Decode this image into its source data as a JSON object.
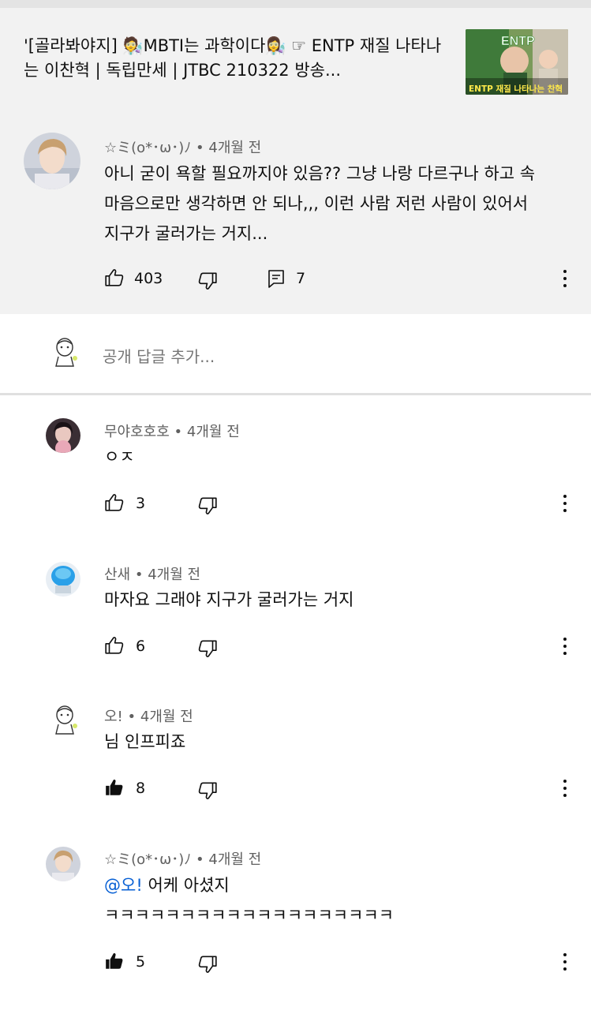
{
  "video": {
    "title": "'[골라봐야지] 🧑‍🔬MBTI는 과학이다👩‍🔬 ☞ ENTP 재질 나타나는 이찬혁 | 독립만세 | JTBC 210322 방송...",
    "thumbnail_tag": "ENTP",
    "thumbnail_caption": "ENTP 재질 나타나는 찬혁"
  },
  "main_comment": {
    "author": "☆ミ(o*･ω･)ﾉ",
    "time": "4개월 전",
    "text": "아니 굳이 욕할 필요까지야 있음?? 그냥 나랑 다르구나 하고 속마음으로만 생각하면 안 되나,,, 이런 사람 저런 사람이 있어서 지구가 굴러가는 거지...",
    "likes": "403",
    "replies": "7"
  },
  "reply_box": {
    "placeholder": "공개 답글 추가..."
  },
  "replies": [
    {
      "author": "무야호호호",
      "time": "4개월 전",
      "text": "ㅇㅈ",
      "likes": "3"
    },
    {
      "author": "산새",
      "time": "4개월 전",
      "text": "마자요 그래야 지구가 굴러가는 거지",
      "likes": "6"
    },
    {
      "author": "오!",
      "time": "4개월 전",
      "text": "님 인프피죠",
      "likes": "8"
    },
    {
      "author": "☆ミ(o*･ω･)ﾉ",
      "time": "4개월 전",
      "mention": "@오!",
      "text": "어케 아셨지",
      "text2": "ㅋㅋㅋㅋㅋㅋㅋㅋㅋㅋㅋㅋㅋㅋㅋㅋㅋㅋㅋ",
      "likes": "5"
    }
  ],
  "separator": "•",
  "colors": {
    "mention": "#065fd4",
    "meta": "#606060",
    "header_bg": "#f2f2f2"
  }
}
